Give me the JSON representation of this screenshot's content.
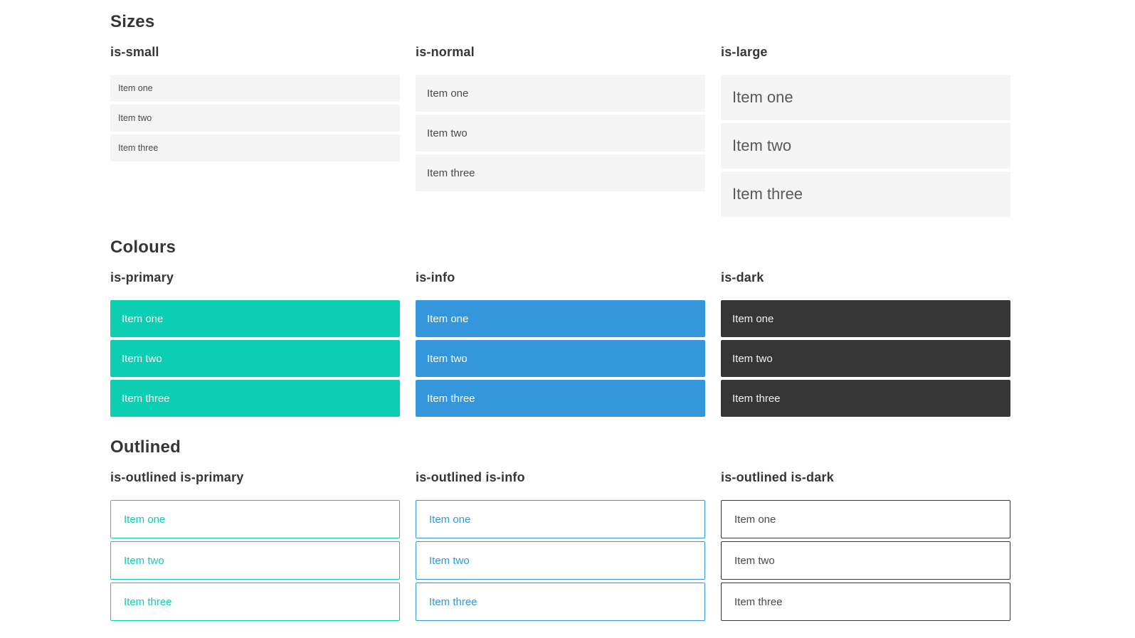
{
  "colors": {
    "page_background": "#ffffff",
    "heading_text": "#363636",
    "item_background": "#f5f5f5",
    "item_text": "#4a4a4a",
    "primary": "#0bceb2",
    "info": "#3497db",
    "dark": "#363636",
    "outlined_dark_text": "#4a4a4a"
  },
  "sections": [
    {
      "title": "Sizes",
      "groups": [
        {
          "label": "is-small",
          "variant": "small",
          "items": [
            "Item one",
            "Item two",
            "Item three"
          ]
        },
        {
          "label": "is-normal",
          "variant": "normal",
          "items": [
            "Item one",
            "Item two",
            "Item three"
          ]
        },
        {
          "label": "is-large",
          "variant": "large",
          "items": [
            "Item one",
            "Item two",
            "Item three"
          ]
        }
      ]
    },
    {
      "title": "Colours",
      "groups": [
        {
          "label": "is-primary",
          "variant": "primary",
          "items": [
            "Item one",
            "Item two",
            "Item three"
          ]
        },
        {
          "label": "is-info",
          "variant": "info",
          "items": [
            "Item one",
            "Item two",
            "Item three"
          ]
        },
        {
          "label": "is-dark",
          "variant": "dark",
          "items": [
            "Item one",
            "Item two",
            "Item three"
          ]
        }
      ]
    },
    {
      "title": "Outlined",
      "groups": [
        {
          "label": "is-outlined is-primary",
          "variant": "outlined-primary",
          "items": [
            "Item one",
            "Item two",
            "Item three"
          ]
        },
        {
          "label": "is-outlined is-info",
          "variant": "outlined-info",
          "items": [
            "Item one",
            "Item two",
            "Item three"
          ]
        },
        {
          "label": "is-outlined is-dark",
          "variant": "outlined-dark",
          "items": [
            "Item one",
            "Item two",
            "Item three"
          ]
        }
      ]
    }
  ]
}
